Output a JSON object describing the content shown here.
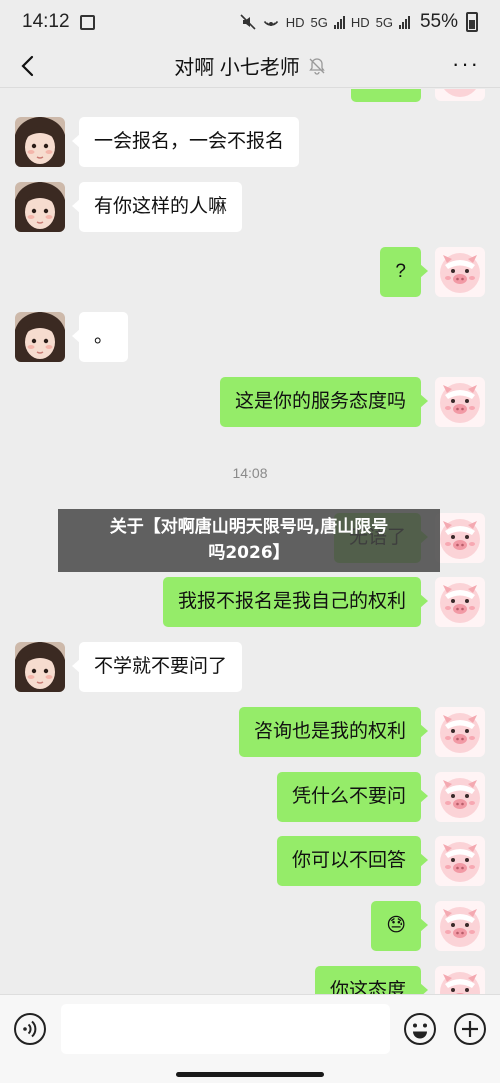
{
  "status_bar": {
    "time": "14:12",
    "net1": "HD",
    "net2": "5G",
    "net3": "HD",
    "net4": "5G",
    "battery": "55%"
  },
  "header": {
    "title": "对啊 小七老师",
    "back_icon": "chevron-left-icon",
    "mute_icon": "bell-off-icon",
    "more_label": "···"
  },
  "timestamps": [
    "14:08"
  ],
  "messages": [
    {
      "side": "in",
      "text": "一会报名，一会不报名"
    },
    {
      "side": "in",
      "text": "有你这样的人嘛"
    },
    {
      "side": "out",
      "text": "?"
    },
    {
      "side": "in",
      "text": "。"
    },
    {
      "side": "out",
      "text": "这是你的服务态度吗"
    },
    {
      "side": "out",
      "text": "无语了"
    },
    {
      "side": "out",
      "text": "我报不报名是我自己的权利"
    },
    {
      "side": "in",
      "text": "不学就不要问了"
    },
    {
      "side": "out",
      "text": "咨询也是我的权利"
    },
    {
      "side": "out",
      "text": "凭什么不要问"
    },
    {
      "side": "out",
      "text": "你可以不回答"
    },
    {
      "side": "out",
      "text": "😓"
    },
    {
      "side": "out",
      "text": "你这态度"
    }
  ],
  "overlay": {
    "line1": "关于【对啊唐山明天限号吗,唐山限号",
    "line2": "吗2026】"
  },
  "input_bar": {
    "placeholder": "",
    "voice_icon": "voice-icon",
    "emoji_icon": "emoji-icon",
    "plus_icon": "plus-icon"
  }
}
